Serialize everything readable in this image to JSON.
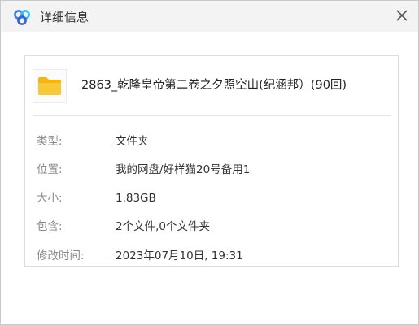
{
  "window": {
    "title": "详细信息",
    "logo_icon": "baidu-netdisk-logo-icon",
    "close_icon": "close-icon"
  },
  "file": {
    "icon": "folder-icon",
    "name": "2863_乾隆皇帝第二卷之夕照空山(纪涵邦）(90回)"
  },
  "details": [
    {
      "label": "类型:",
      "value": "文件夹"
    },
    {
      "label": "位置:",
      "value": "我的网盘/好样猫20号备用1"
    },
    {
      "label": "大小:",
      "value": "1.83GB"
    },
    {
      "label": "包含:",
      "value": "2个文件,0个文件夹"
    },
    {
      "label": "修改时间:",
      "value": "2023年07月10日, 19:31"
    }
  ],
  "colors": {
    "folder": "#f7c21a",
    "titlebar": "#f3f3f3",
    "label": "#8a8a8a"
  }
}
